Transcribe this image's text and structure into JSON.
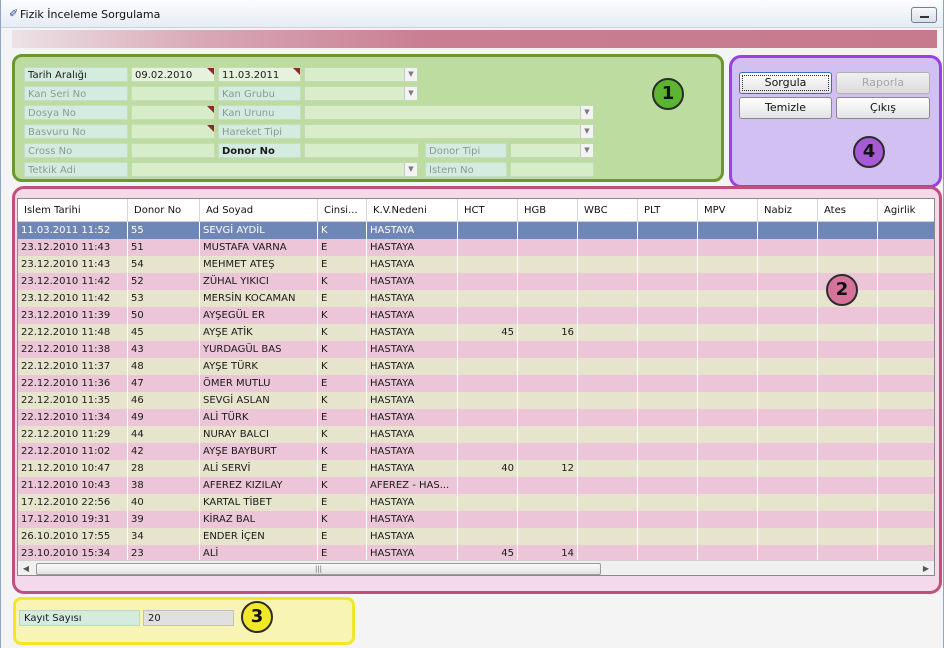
{
  "window": {
    "title": "Fizik İnceleme Sorgulama"
  },
  "filters": {
    "tarih_araligi": {
      "label": "Tarih Aralığı",
      "start": "09.02.2010",
      "end": "11.03.2011"
    },
    "kan_seri_no": {
      "label": "Kan Seri No"
    },
    "kan_grubu": {
      "label": "Kan Grubu"
    },
    "dosya_no": {
      "label": "Dosya No"
    },
    "kan_urunu": {
      "label": "Kan Urunu"
    },
    "basvuru_no": {
      "label": "Basvuru No"
    },
    "hareket_tipi": {
      "label": "Hareket Tipi"
    },
    "cross_no": {
      "label": "Cross No"
    },
    "donor_no": {
      "label": "Donor No"
    },
    "donor_tipi": {
      "label": "Donor Tipi"
    },
    "tetkik_adi": {
      "label": "Tetkik Adi"
    },
    "istem_no": {
      "label": "Istem No"
    }
  },
  "actions": {
    "sorgula": "Sorgula",
    "raporla": "Raporla",
    "temizle": "Temizle",
    "cikis": "Çıkış"
  },
  "markers": {
    "m1": "1",
    "m2": "2",
    "m3": "3",
    "m4": "4"
  },
  "grid": {
    "columns": [
      "Islem Tarihi",
      "Donor No",
      "Ad Soyad",
      "Cinsi...",
      "K.V.Nedeni",
      "HCT",
      "HGB",
      "WBC",
      "PLT",
      "MPV",
      "Nabiz",
      "Ates",
      "Agirlik"
    ],
    "selected_row": 0,
    "rows": [
      [
        "11.03.2011 11:52",
        "55",
        "SEVGİ AYDİL",
        "K",
        "HASTAYA",
        "",
        "",
        "",
        "",
        "",
        "",
        "",
        ""
      ],
      [
        "23.12.2010 11:43",
        "51",
        "MUSTAFA VARNA",
        "E",
        "HASTAYA",
        "",
        "",
        "",
        "",
        "",
        "",
        "",
        ""
      ],
      [
        "23.12.2010 11:43",
        "54",
        "MEHMET ATEŞ",
        "E",
        "HASTAYA",
        "",
        "",
        "",
        "",
        "",
        "",
        "",
        ""
      ],
      [
        "23.12.2010 11:42",
        "52",
        "ZÜHAL YIKICI",
        "K",
        "HASTAYA",
        "",
        "",
        "",
        "",
        "",
        "",
        "",
        ""
      ],
      [
        "23.12.2010 11:42",
        "53",
        "MERSİN KOCAMAN",
        "E",
        "HASTAYA",
        "",
        "",
        "",
        "",
        "",
        "",
        "",
        ""
      ],
      [
        "23.12.2010 11:39",
        "50",
        "AYŞEGÜL ER",
        "K",
        "HASTAYA",
        "",
        "",
        "",
        "",
        "",
        "",
        "",
        ""
      ],
      [
        "22.12.2010 11:48",
        "45",
        "AYŞE ATİK",
        "K",
        "HASTAYA",
        "45",
        "16",
        "",
        "",
        "",
        "",
        "",
        ""
      ],
      [
        "22.12.2010 11:38",
        "43",
        "YURDAGÜL BAS",
        "K",
        "HASTAYA",
        "",
        "",
        "",
        "",
        "",
        "",
        "",
        ""
      ],
      [
        "22.12.2010 11:37",
        "48",
        "AYŞE TÜRK",
        "K",
        "HASTAYA",
        "",
        "",
        "",
        "",
        "",
        "",
        "",
        ""
      ],
      [
        "22.12.2010 11:36",
        "47",
        "ÖMER MUTLU",
        "E",
        "HASTAYA",
        "",
        "",
        "",
        "",
        "",
        "",
        "",
        ""
      ],
      [
        "22.12.2010 11:35",
        "46",
        "SEVGİ ASLAN",
        "K",
        "HASTAYA",
        "",
        "",
        "",
        "",
        "",
        "",
        "",
        ""
      ],
      [
        "22.12.2010 11:34",
        "49",
        "ALİ TÜRK",
        "E",
        "HASTAYA",
        "",
        "",
        "",
        "",
        "",
        "",
        "",
        ""
      ],
      [
        "22.12.2010 11:29",
        "44",
        "NURAY BALCI",
        "K",
        "HASTAYA",
        "",
        "",
        "",
        "",
        "",
        "",
        "",
        ""
      ],
      [
        "22.12.2010 11:02",
        "42",
        "AYŞE BAYBURT",
        "K",
        "HASTAYA",
        "",
        "",
        "",
        "",
        "",
        "",
        "",
        ""
      ],
      [
        "21.12.2010 10:47",
        "28",
        "ALİ SERVİ",
        "E",
        "HASTAYA",
        "40",
        "12",
        "",
        "",
        "",
        "",
        "",
        ""
      ],
      [
        "21.12.2010 10:43",
        "38",
        "AFEREZ KIZILAY",
        "K",
        "AFEREZ - HAS...",
        "",
        "",
        "",
        "",
        "",
        "",
        "",
        ""
      ],
      [
        "17.12.2010 22:56",
        "40",
        "KARTAL TİBET",
        "E",
        "HASTAYA",
        "",
        "",
        "",
        "",
        "",
        "",
        "",
        ""
      ],
      [
        "17.12.2010 19:31",
        "39",
        "KİRAZ BAL",
        "K",
        "HASTAYA",
        "",
        "",
        "",
        "",
        "",
        "",
        "",
        ""
      ],
      [
        "26.10.2010 17:55",
        "34",
        "ENDER İÇEN",
        "E",
        "HASTAYA",
        "",
        "",
        "",
        "",
        "",
        "",
        "",
        ""
      ],
      [
        "23.10.2010 15:34",
        "23",
        "ALİ",
        "E",
        "HASTAYA",
        "45",
        "14",
        "",
        "",
        "",
        "",
        "",
        ""
      ]
    ]
  },
  "footer": {
    "kayit_sayisi_label": "Kayıt Sayısı",
    "kayit_sayisi_value": "20"
  }
}
